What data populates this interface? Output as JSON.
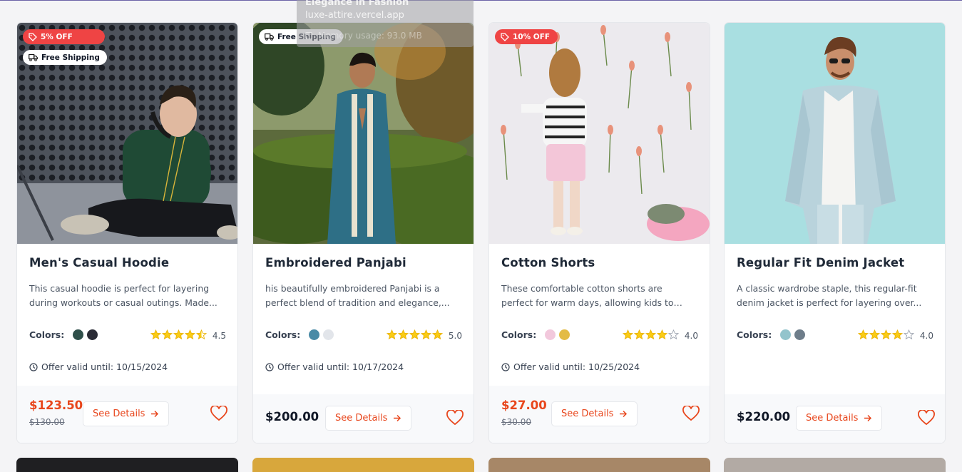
{
  "colors": {
    "accent": "#e8461c",
    "badge_red": "#ef4444",
    "star": "#facc15"
  },
  "products": [
    {
      "title": "Men's Casual Hoodie",
      "description": "This casual hoodie is perfect for layering during workouts or casual outings. Made...",
      "discount_badge": "5% OFF",
      "shipping_badge": "Free Shipping",
      "colors_label": "Colors:",
      "swatches": [
        "#2f4f4a",
        "#2a2b35"
      ],
      "rating": "4.5",
      "rating_value": 4.5,
      "offer": "Offer valid until: 10/15/2024",
      "price": "$123.50",
      "old_price": "$130.00",
      "details_label": "See Details"
    },
    {
      "title": "Embroidered Panjabi",
      "description": "his beautifully embroidered Panjabi is a perfect blend of tradition and elegance,...",
      "shipping_badge": "Free Shipping",
      "colors_label": "Colors:",
      "swatches": [
        "#4a8aa6",
        "#e2e5ea"
      ],
      "rating": "5.0",
      "rating_value": 5,
      "offer": "Offer valid until: 10/17/2024",
      "price": "$200.00",
      "details_label": "See Details"
    },
    {
      "title": "Cotton Shorts",
      "description": "These comfortable cotton shorts are perfect for warm days, allowing kids to move freel...",
      "discount_badge": "10% OFF",
      "colors_label": "Colors:",
      "swatches": [
        "#f2c8dc",
        "#e3bb45"
      ],
      "rating": "4.0",
      "rating_value": 4,
      "offer": "Offer valid until: 10/25/2024",
      "price": "$27.00",
      "old_price": "$30.00",
      "details_label": "See Details"
    },
    {
      "title": "Regular Fit Denim Jacket",
      "description": "A classic wardrobe staple, this regular-fit denim jacket is perfect for layering over...",
      "colors_label": "Colors:",
      "swatches": [
        "#93c4cc",
        "#6e7d8a"
      ],
      "rating": "4.0",
      "rating_value": 4,
      "price": "$220.00",
      "details_label": "See Details"
    }
  ],
  "tooltip": {
    "title": "Elegance in Fashion",
    "url": "luxe-attire.vercel.app",
    "memory": "Memory usage: 93.0 MB"
  }
}
